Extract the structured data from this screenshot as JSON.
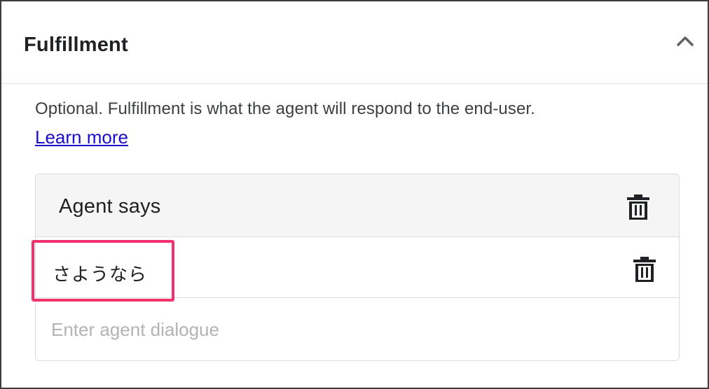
{
  "fulfillment": {
    "title": "Fulfillment",
    "collapse_icon": "chevron-up-icon",
    "description": "Optional. Fulfillment is what the agent will respond to the end-user.",
    "learn_more": "Learn more"
  },
  "agent_says": {
    "title": "Agent says",
    "delete_icon": "trash-icon",
    "responses": [
      {
        "text": "さようなら",
        "delete_icon": "trash-icon"
      }
    ],
    "input": {
      "value": "",
      "placeholder": "Enter agent dialogue"
    }
  },
  "colors": {
    "highlight": "#f0336f",
    "link": "#1a0dcc",
    "card_header_bg": "#f5f5f5"
  }
}
